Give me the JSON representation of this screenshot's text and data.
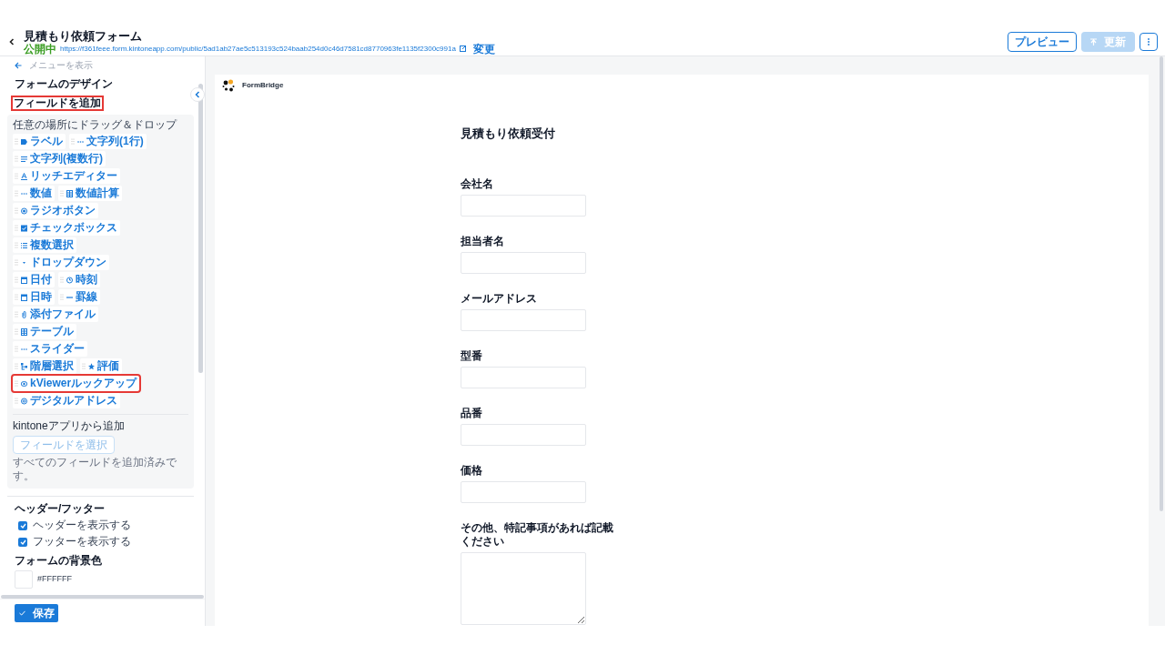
{
  "header": {
    "title": "見積もり依頼フォーム",
    "status": "公開中",
    "url": "https://f361feee.form.kintoneapp.com/public/5ad1ab27ae5c513193c524baab254d0c46d7581cd8770963fe1135f2300c991a",
    "change_link": "変更",
    "buttons": [
      {
        "label": "プレビュー",
        "disabled": false
      },
      {
        "label": "更新",
        "disabled": true
      }
    ]
  },
  "sidebar": {
    "menu_link": "メニューを表示",
    "title": "フォームのデザイン",
    "add_field": {
      "heading": "フィールドを追加",
      "highlighted": true,
      "hint": "任意の場所にドラッグ＆ドロップ",
      "rows": [
        [
          {
            "label": "ラベル",
            "kind": "label",
            "highlighted": false
          },
          {
            "label": "文字列(1行)",
            "kind": "dots",
            "highlighted": false
          }
        ],
        [
          {
            "label": "文字列(複数行)",
            "kind": "lines",
            "highlighted": false
          }
        ],
        [
          {
            "label": "リッチエディター",
            "kind": "richtext",
            "highlighted": false
          }
        ],
        [
          {
            "label": "数値",
            "kind": "dots",
            "highlighted": false
          },
          {
            "label": "数値計算",
            "kind": "grid",
            "highlighted": false
          }
        ],
        [
          {
            "label": "ラジオボタン",
            "kind": "radio",
            "highlighted": false
          }
        ],
        [
          {
            "label": "チェックボックス",
            "kind": "checkbox",
            "highlighted": false
          }
        ],
        [
          {
            "label": "複数選択",
            "kind": "list",
            "highlighted": false
          }
        ],
        [
          {
            "label": "ドロップダウン",
            "kind": "caret",
            "highlighted": false
          }
        ],
        [
          {
            "label": "日付",
            "kind": "calendar",
            "highlighted": false
          },
          {
            "label": "時刻",
            "kind": "clock",
            "highlighted": false
          }
        ],
        [
          {
            "label": "日時",
            "kind": "calendar",
            "highlighted": false
          },
          {
            "label": "罫線",
            "kind": "rule",
            "highlighted": false
          }
        ],
        [
          {
            "label": "添付ファイル",
            "kind": "clip",
            "highlighted": false
          }
        ],
        [
          {
            "label": "テーブル",
            "kind": "grid",
            "highlighted": false
          }
        ],
        [
          {
            "label": "スライダー",
            "kind": "dots",
            "highlighted": false
          }
        ],
        [
          {
            "label": "階層選択",
            "kind": "tree",
            "highlighted": false
          },
          {
            "label": "評価",
            "kind": "star",
            "highlighted": false
          }
        ],
        [
          {
            "label": "kViewerルックアップ",
            "kind": "eye",
            "highlighted": true
          }
        ],
        [
          {
            "label": "デジタルアドレス",
            "kind": "at",
            "highlighted": false
          }
        ]
      ]
    },
    "kintone": {
      "heading": "kintoneアプリから追加",
      "button": {
        "label": "フィールドを選択",
        "disabled": true
      },
      "note": "すべてのフィールドを追加済みです。"
    },
    "header_footer": {
      "heading": "ヘッダー/フッター",
      "options": [
        {
          "label": "ヘッダーを表示する",
          "checked": true
        },
        {
          "label": "フッターを表示する",
          "checked": true
        }
      ]
    },
    "background": {
      "heading": "フォームの背景色",
      "color": "#ffffff",
      "value": "#FFFFFF"
    },
    "save_button": "保存"
  },
  "form": {
    "brand": "FormBridge",
    "title": "見積もり依頼受付",
    "fields": [
      {
        "label": "会社名",
        "kind": "text"
      },
      {
        "label": "担当者名",
        "kind": "text"
      },
      {
        "label": "メールアドレス",
        "kind": "text"
      },
      {
        "label": "型番",
        "kind": "text"
      },
      {
        "label": "品番",
        "kind": "text"
      },
      {
        "label": "価格",
        "kind": "text"
      },
      {
        "label": "その他、特記事項があれば記載ください",
        "kind": "textarea"
      }
    ]
  }
}
